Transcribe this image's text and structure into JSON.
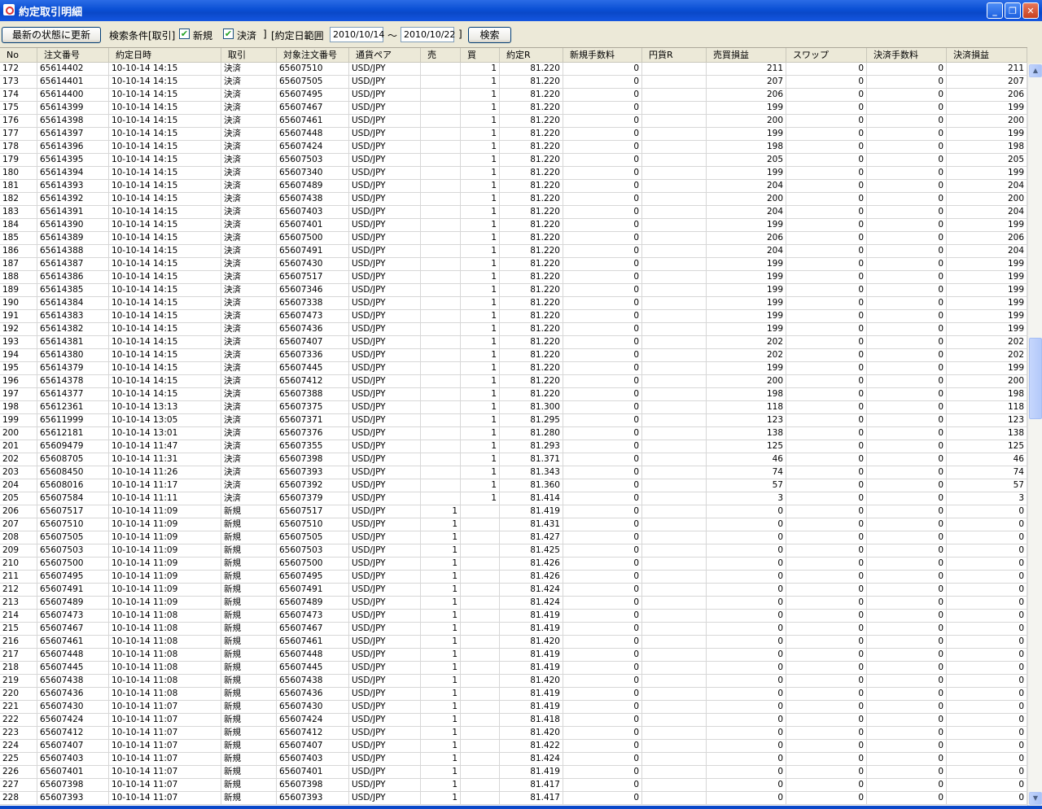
{
  "window": {
    "title": "約定取引明細",
    "min_icon": "minimize-icon",
    "max_icon": "maximize-icon",
    "close_icon": "close-icon"
  },
  "toolbar": {
    "refresh_label": "最新の状態に更新",
    "search_condition_label": "検索条件[取引]",
    "new_checked": true,
    "new_label": "新規",
    "settle_checked": true,
    "settle_label": "決済",
    "bracket_close": "]",
    "date_range_label": "[約定日範囲",
    "date_from": "2010/10/14",
    "tilde": "～",
    "date_to": "2010/10/22",
    "bracket_close2": "]",
    "search_button": "検索"
  },
  "table": {
    "columns": [
      "No",
      "注文番号",
      "約定日時",
      "取引",
      "対象注文番号",
      "通貨ペア",
      "売",
      "買",
      "約定R",
      "新規手数料",
      "円貨R",
      "売買損益",
      "スワップ",
      "決済手数料",
      "決済損益"
    ],
    "rows": [
      [
        "172",
        "65614402",
        "10-10-14 14:15",
        "決済",
        "65607510",
        "USD/JPY",
        "",
        "1",
        "81.220",
        "0",
        "",
        "211",
        "0",
        "0",
        "211"
      ],
      [
        "173",
        "65614401",
        "10-10-14 14:15",
        "決済",
        "65607505",
        "USD/JPY",
        "",
        "1",
        "81.220",
        "0",
        "",
        "207",
        "0",
        "0",
        "207"
      ],
      [
        "174",
        "65614400",
        "10-10-14 14:15",
        "決済",
        "65607495",
        "USD/JPY",
        "",
        "1",
        "81.220",
        "0",
        "",
        "206",
        "0",
        "0",
        "206"
      ],
      [
        "175",
        "65614399",
        "10-10-14 14:15",
        "決済",
        "65607467",
        "USD/JPY",
        "",
        "1",
        "81.220",
        "0",
        "",
        "199",
        "0",
        "0",
        "199"
      ],
      [
        "176",
        "65614398",
        "10-10-14 14:15",
        "決済",
        "65607461",
        "USD/JPY",
        "",
        "1",
        "81.220",
        "0",
        "",
        "200",
        "0",
        "0",
        "200"
      ],
      [
        "177",
        "65614397",
        "10-10-14 14:15",
        "決済",
        "65607448",
        "USD/JPY",
        "",
        "1",
        "81.220",
        "0",
        "",
        "199",
        "0",
        "0",
        "199"
      ],
      [
        "178",
        "65614396",
        "10-10-14 14:15",
        "決済",
        "65607424",
        "USD/JPY",
        "",
        "1",
        "81.220",
        "0",
        "",
        "198",
        "0",
        "0",
        "198"
      ],
      [
        "179",
        "65614395",
        "10-10-14 14:15",
        "決済",
        "65607503",
        "USD/JPY",
        "",
        "1",
        "81.220",
        "0",
        "",
        "205",
        "0",
        "0",
        "205"
      ],
      [
        "180",
        "65614394",
        "10-10-14 14:15",
        "決済",
        "65607340",
        "USD/JPY",
        "",
        "1",
        "81.220",
        "0",
        "",
        "199",
        "0",
        "0",
        "199"
      ],
      [
        "181",
        "65614393",
        "10-10-14 14:15",
        "決済",
        "65607489",
        "USD/JPY",
        "",
        "1",
        "81.220",
        "0",
        "",
        "204",
        "0",
        "0",
        "204"
      ],
      [
        "182",
        "65614392",
        "10-10-14 14:15",
        "決済",
        "65607438",
        "USD/JPY",
        "",
        "1",
        "81.220",
        "0",
        "",
        "200",
        "0",
        "0",
        "200"
      ],
      [
        "183",
        "65614391",
        "10-10-14 14:15",
        "決済",
        "65607403",
        "USD/JPY",
        "",
        "1",
        "81.220",
        "0",
        "",
        "204",
        "0",
        "0",
        "204"
      ],
      [
        "184",
        "65614390",
        "10-10-14 14:15",
        "決済",
        "65607401",
        "USD/JPY",
        "",
        "1",
        "81.220",
        "0",
        "",
        "199",
        "0",
        "0",
        "199"
      ],
      [
        "185",
        "65614389",
        "10-10-14 14:15",
        "決済",
        "65607500",
        "USD/JPY",
        "",
        "1",
        "81.220",
        "0",
        "",
        "206",
        "0",
        "0",
        "206"
      ],
      [
        "186",
        "65614388",
        "10-10-14 14:15",
        "決済",
        "65607491",
        "USD/JPY",
        "",
        "1",
        "81.220",
        "0",
        "",
        "204",
        "0",
        "0",
        "204"
      ],
      [
        "187",
        "65614387",
        "10-10-14 14:15",
        "決済",
        "65607430",
        "USD/JPY",
        "",
        "1",
        "81.220",
        "0",
        "",
        "199",
        "0",
        "0",
        "199"
      ],
      [
        "188",
        "65614386",
        "10-10-14 14:15",
        "決済",
        "65607517",
        "USD/JPY",
        "",
        "1",
        "81.220",
        "0",
        "",
        "199",
        "0",
        "0",
        "199"
      ],
      [
        "189",
        "65614385",
        "10-10-14 14:15",
        "決済",
        "65607346",
        "USD/JPY",
        "",
        "1",
        "81.220",
        "0",
        "",
        "199",
        "0",
        "0",
        "199"
      ],
      [
        "190",
        "65614384",
        "10-10-14 14:15",
        "決済",
        "65607338",
        "USD/JPY",
        "",
        "1",
        "81.220",
        "0",
        "",
        "199",
        "0",
        "0",
        "199"
      ],
      [
        "191",
        "65614383",
        "10-10-14 14:15",
        "決済",
        "65607473",
        "USD/JPY",
        "",
        "1",
        "81.220",
        "0",
        "",
        "199",
        "0",
        "0",
        "199"
      ],
      [
        "192",
        "65614382",
        "10-10-14 14:15",
        "決済",
        "65607436",
        "USD/JPY",
        "",
        "1",
        "81.220",
        "0",
        "",
        "199",
        "0",
        "0",
        "199"
      ],
      [
        "193",
        "65614381",
        "10-10-14 14:15",
        "決済",
        "65607407",
        "USD/JPY",
        "",
        "1",
        "81.220",
        "0",
        "",
        "202",
        "0",
        "0",
        "202"
      ],
      [
        "194",
        "65614380",
        "10-10-14 14:15",
        "決済",
        "65607336",
        "USD/JPY",
        "",
        "1",
        "81.220",
        "0",
        "",
        "202",
        "0",
        "0",
        "202"
      ],
      [
        "195",
        "65614379",
        "10-10-14 14:15",
        "決済",
        "65607445",
        "USD/JPY",
        "",
        "1",
        "81.220",
        "0",
        "",
        "199",
        "0",
        "0",
        "199"
      ],
      [
        "196",
        "65614378",
        "10-10-14 14:15",
        "決済",
        "65607412",
        "USD/JPY",
        "",
        "1",
        "81.220",
        "0",
        "",
        "200",
        "0",
        "0",
        "200"
      ],
      [
        "197",
        "65614377",
        "10-10-14 14:15",
        "決済",
        "65607388",
        "USD/JPY",
        "",
        "1",
        "81.220",
        "0",
        "",
        "198",
        "0",
        "0",
        "198"
      ],
      [
        "198",
        "65612361",
        "10-10-14 13:13",
        "決済",
        "65607375",
        "USD/JPY",
        "",
        "1",
        "81.300",
        "0",
        "",
        "118",
        "0",
        "0",
        "118"
      ],
      [
        "199",
        "65611999",
        "10-10-14 13:05",
        "決済",
        "65607371",
        "USD/JPY",
        "",
        "1",
        "81.295",
        "0",
        "",
        "123",
        "0",
        "0",
        "123"
      ],
      [
        "200",
        "65612181",
        "10-10-14 13:01",
        "決済",
        "65607376",
        "USD/JPY",
        "",
        "1",
        "81.280",
        "0",
        "",
        "138",
        "0",
        "0",
        "138"
      ],
      [
        "201",
        "65609479",
        "10-10-14 11:47",
        "決済",
        "65607355",
        "USD/JPY",
        "",
        "1",
        "81.293",
        "0",
        "",
        "125",
        "0",
        "0",
        "125"
      ],
      [
        "202",
        "65608705",
        "10-10-14 11:31",
        "決済",
        "65607398",
        "USD/JPY",
        "",
        "1",
        "81.371",
        "0",
        "",
        "46",
        "0",
        "0",
        "46"
      ],
      [
        "203",
        "65608450",
        "10-10-14 11:26",
        "決済",
        "65607393",
        "USD/JPY",
        "",
        "1",
        "81.343",
        "0",
        "",
        "74",
        "0",
        "0",
        "74"
      ],
      [
        "204",
        "65608016",
        "10-10-14 11:17",
        "決済",
        "65607392",
        "USD/JPY",
        "",
        "1",
        "81.360",
        "0",
        "",
        "57",
        "0",
        "0",
        "57"
      ],
      [
        "205",
        "65607584",
        "10-10-14 11:11",
        "決済",
        "65607379",
        "USD/JPY",
        "",
        "1",
        "81.414",
        "0",
        "",
        "3",
        "0",
        "0",
        "3"
      ],
      [
        "206",
        "65607517",
        "10-10-14 11:09",
        "新規",
        "65607517",
        "USD/JPY",
        "1",
        "",
        "81.419",
        "0",
        "",
        "0",
        "0",
        "0",
        "0"
      ],
      [
        "207",
        "65607510",
        "10-10-14 11:09",
        "新規",
        "65607510",
        "USD/JPY",
        "1",
        "",
        "81.431",
        "0",
        "",
        "0",
        "0",
        "0",
        "0"
      ],
      [
        "208",
        "65607505",
        "10-10-14 11:09",
        "新規",
        "65607505",
        "USD/JPY",
        "1",
        "",
        "81.427",
        "0",
        "",
        "0",
        "0",
        "0",
        "0"
      ],
      [
        "209",
        "65607503",
        "10-10-14 11:09",
        "新規",
        "65607503",
        "USD/JPY",
        "1",
        "",
        "81.425",
        "0",
        "",
        "0",
        "0",
        "0",
        "0"
      ],
      [
        "210",
        "65607500",
        "10-10-14 11:09",
        "新規",
        "65607500",
        "USD/JPY",
        "1",
        "",
        "81.426",
        "0",
        "",
        "0",
        "0",
        "0",
        "0"
      ],
      [
        "211",
        "65607495",
        "10-10-14 11:09",
        "新規",
        "65607495",
        "USD/JPY",
        "1",
        "",
        "81.426",
        "0",
        "",
        "0",
        "0",
        "0",
        "0"
      ],
      [
        "212",
        "65607491",
        "10-10-14 11:09",
        "新規",
        "65607491",
        "USD/JPY",
        "1",
        "",
        "81.424",
        "0",
        "",
        "0",
        "0",
        "0",
        "0"
      ],
      [
        "213",
        "65607489",
        "10-10-14 11:09",
        "新規",
        "65607489",
        "USD/JPY",
        "1",
        "",
        "81.424",
        "0",
        "",
        "0",
        "0",
        "0",
        "0"
      ],
      [
        "214",
        "65607473",
        "10-10-14 11:08",
        "新規",
        "65607473",
        "USD/JPY",
        "1",
        "",
        "81.419",
        "0",
        "",
        "0",
        "0",
        "0",
        "0"
      ],
      [
        "215",
        "65607467",
        "10-10-14 11:08",
        "新規",
        "65607467",
        "USD/JPY",
        "1",
        "",
        "81.419",
        "0",
        "",
        "0",
        "0",
        "0",
        "0"
      ],
      [
        "216",
        "65607461",
        "10-10-14 11:08",
        "新規",
        "65607461",
        "USD/JPY",
        "1",
        "",
        "81.420",
        "0",
        "",
        "0",
        "0",
        "0",
        "0"
      ],
      [
        "217",
        "65607448",
        "10-10-14 11:08",
        "新規",
        "65607448",
        "USD/JPY",
        "1",
        "",
        "81.419",
        "0",
        "",
        "0",
        "0",
        "0",
        "0"
      ],
      [
        "218",
        "65607445",
        "10-10-14 11:08",
        "新規",
        "65607445",
        "USD/JPY",
        "1",
        "",
        "81.419",
        "0",
        "",
        "0",
        "0",
        "0",
        "0"
      ],
      [
        "219",
        "65607438",
        "10-10-14 11:08",
        "新規",
        "65607438",
        "USD/JPY",
        "1",
        "",
        "81.420",
        "0",
        "",
        "0",
        "0",
        "0",
        "0"
      ],
      [
        "220",
        "65607436",
        "10-10-14 11:08",
        "新規",
        "65607436",
        "USD/JPY",
        "1",
        "",
        "81.419",
        "0",
        "",
        "0",
        "0",
        "0",
        "0"
      ],
      [
        "221",
        "65607430",
        "10-10-14 11:07",
        "新規",
        "65607430",
        "USD/JPY",
        "1",
        "",
        "81.419",
        "0",
        "",
        "0",
        "0",
        "0",
        "0"
      ],
      [
        "222",
        "65607424",
        "10-10-14 11:07",
        "新規",
        "65607424",
        "USD/JPY",
        "1",
        "",
        "81.418",
        "0",
        "",
        "0",
        "0",
        "0",
        "0"
      ],
      [
        "223",
        "65607412",
        "10-10-14 11:07",
        "新規",
        "65607412",
        "USD/JPY",
        "1",
        "",
        "81.420",
        "0",
        "",
        "0",
        "0",
        "0",
        "0"
      ],
      [
        "224",
        "65607407",
        "10-10-14 11:07",
        "新規",
        "65607407",
        "USD/JPY",
        "1",
        "",
        "81.422",
        "0",
        "",
        "0",
        "0",
        "0",
        "0"
      ],
      [
        "225",
        "65607403",
        "10-10-14 11:07",
        "新規",
        "65607403",
        "USD/JPY",
        "1",
        "",
        "81.424",
        "0",
        "",
        "0",
        "0",
        "0",
        "0"
      ],
      [
        "226",
        "65607401",
        "10-10-14 11:07",
        "新規",
        "65607401",
        "USD/JPY",
        "1",
        "",
        "81.419",
        "0",
        "",
        "0",
        "0",
        "0",
        "0"
      ],
      [
        "227",
        "65607398",
        "10-10-14 11:07",
        "新規",
        "65607398",
        "USD/JPY",
        "1",
        "",
        "81.417",
        "0",
        "",
        "0",
        "0",
        "0",
        "0"
      ],
      [
        "228",
        "65607393",
        "10-10-14 11:07",
        "新規",
        "65607393",
        "USD/JPY",
        "1",
        "",
        "81.417",
        "0",
        "",
        "0",
        "0",
        "0",
        "0"
      ]
    ]
  },
  "scrollbar": {
    "up_icon": "scroll-up-arrow-icon",
    "down_icon": "scroll-down-arrow-icon"
  }
}
